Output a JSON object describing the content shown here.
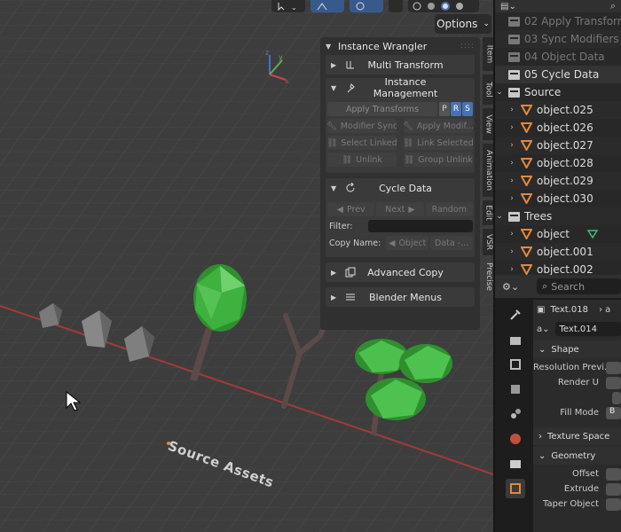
{
  "viewport": {
    "options_label": "Options",
    "label_3d": "Source Assets",
    "gizmo_axes": [
      "z",
      "y",
      "x"
    ]
  },
  "npanel": {
    "title": "Instance Wrangler",
    "multi_transform": "Multi Transform",
    "instance_management": {
      "title": "Instance Management",
      "apply_transforms": "Apply Transforms",
      "prs": [
        "P",
        "R",
        "S"
      ],
      "modifier_sync": "Modifier Sync",
      "apply_modif": "Apply Modif...",
      "select_linked": "Select Linked",
      "link_selected": "Link Selected",
      "unlink": "Unlink",
      "group_unlink": "Group Unlink"
    },
    "cycle_data": {
      "title": "Cycle Data",
      "prev": "Prev",
      "next": "Next",
      "random": "Random",
      "filter_label": "Filter:",
      "copy_name_label": "Copy Name:",
      "object_btn": "Object",
      "data_btn": "Data -..."
    },
    "advanced_copy": "Advanced Copy",
    "blender_menus": "Blender Menus"
  },
  "sidetabs": [
    "Item",
    "Tool",
    "View",
    "Animation",
    "Edit",
    "VSR",
    "Precise"
  ],
  "outliner": {
    "rows": [
      {
        "label": "02 Apply Transform",
        "kind": "dim"
      },
      {
        "label": "03 Sync Modifiers",
        "kind": "dim"
      },
      {
        "label": "04 Object Data",
        "kind": "dim"
      },
      {
        "label": "05 Cycle Data",
        "kind": "coll"
      },
      {
        "label": "Source",
        "kind": "coll-open"
      },
      {
        "label": "object.025",
        "kind": "obj"
      },
      {
        "label": "object.026",
        "kind": "obj"
      },
      {
        "label": "object.027",
        "kind": "obj"
      },
      {
        "label": "object.028",
        "kind": "obj"
      },
      {
        "label": "object.029",
        "kind": "obj"
      },
      {
        "label": "object.030",
        "kind": "obj"
      },
      {
        "label": "Trees",
        "kind": "coll-open"
      },
      {
        "label": "object",
        "kind": "obj"
      },
      {
        "label": "object.001",
        "kind": "obj"
      },
      {
        "label": "object.002",
        "kind": "obj"
      }
    ]
  },
  "properties": {
    "search_placeholder": "Search",
    "datablock": "Text.018",
    "data_name": "Text.014",
    "shape_section": "Shape",
    "resolution_preview": "Resolution Previ...",
    "render_u": "Render U",
    "fill_mode": "Fill Mode",
    "fill_mode_value": "B",
    "texture_space": "Texture Space",
    "geometry": "Geometry",
    "offset": "Offset",
    "extrude": "Extrude",
    "taper_object": "Taper Object"
  },
  "colors": {
    "accent": "#4772b3",
    "object_orange": "#e08a3c",
    "tree_green": "#3fa63f",
    "trunk": "#5c4a48"
  }
}
